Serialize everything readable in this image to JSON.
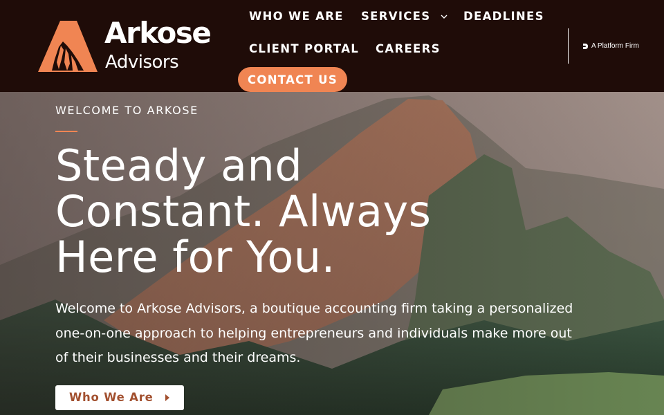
{
  "brand": {
    "name_line1": "Arkose",
    "name_line2": "Advisors",
    "logo_icon": "mountain-peak-icon",
    "accent_color": "#f08553",
    "header_bg": "#1f0c08"
  },
  "nav": {
    "who_we_are": "WHO WE ARE",
    "services": "SERVICES",
    "deadlines": "DEADLINES",
    "client_portal": "CLIENT PORTAL",
    "careers": "CAREERS",
    "contact": "CONTACT US"
  },
  "platform_badge": {
    "text": "A Platform Firm",
    "icon": "platform-logo-icon"
  },
  "hero": {
    "eyebrow": "WELCOME TO ARKOSE",
    "headline": "Steady and Constant. Always Here for You.",
    "intro": "Welcome to Arkose Advisors, a boutique accounting firm taking a personalized one-on-one approach to helping entrepreneurs and individuals make more out of their businesses and their dreams.",
    "cta_label": "Who We Are",
    "cta_color": "#a2502f"
  }
}
